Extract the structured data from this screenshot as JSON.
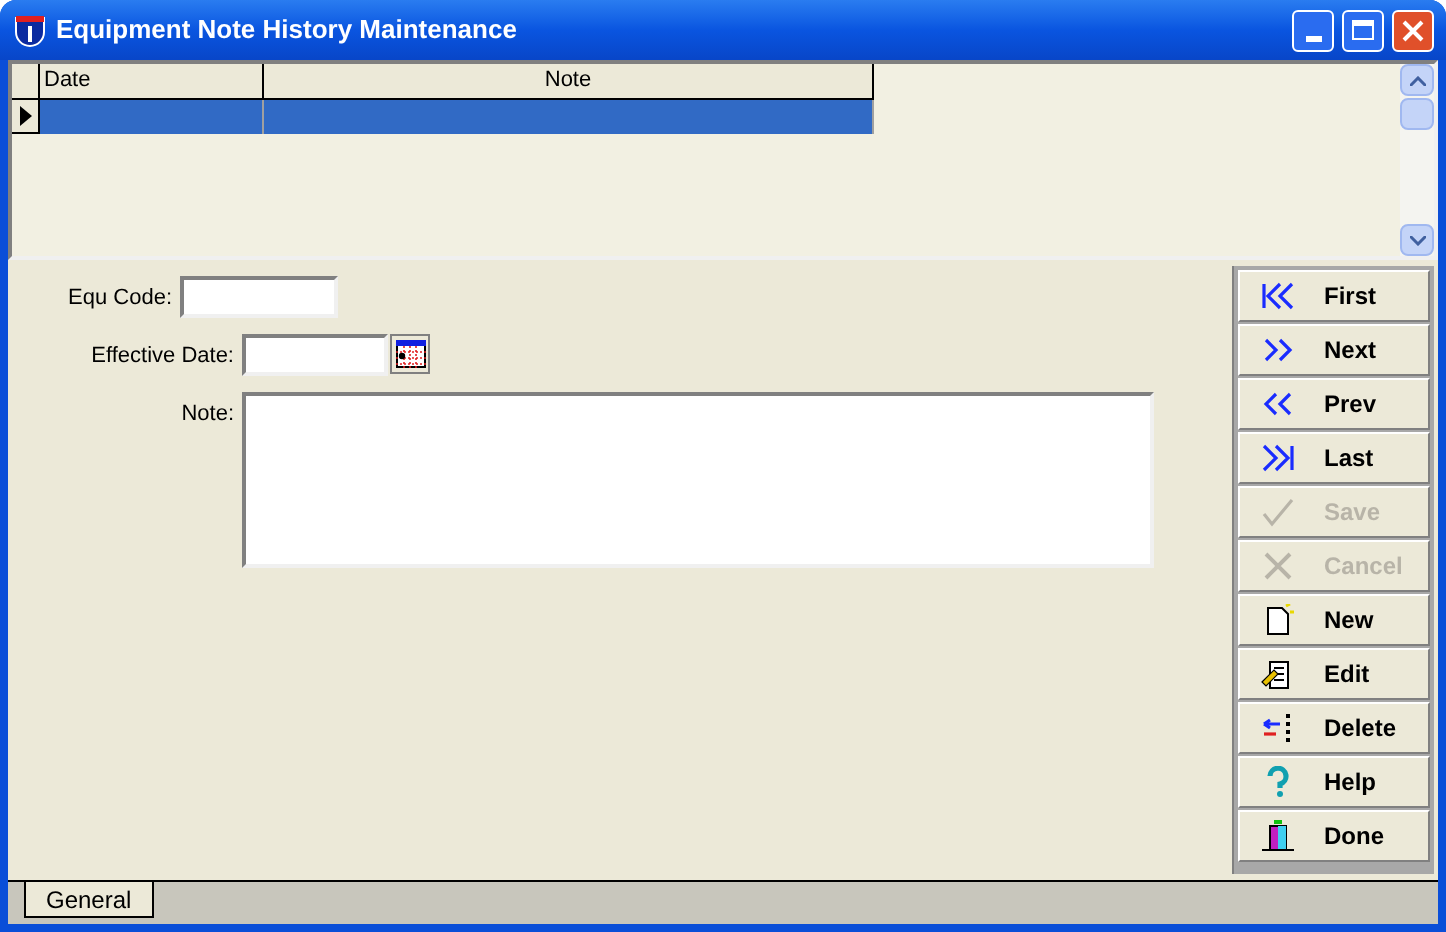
{
  "window": {
    "title": "Equipment Note History Maintenance"
  },
  "grid": {
    "columns": [
      "Date",
      "Note"
    ],
    "rows": [
      {
        "selected": true,
        "cells": [
          "",
          ""
        ]
      }
    ]
  },
  "form": {
    "fields": [
      {
        "label": "Equ Code:",
        "kind": "text"
      },
      {
        "label": "Effective Date:",
        "kind": "date"
      },
      {
        "label": "Note:",
        "kind": "memo"
      }
    ]
  },
  "buttons": [
    {
      "label": "First",
      "kind": "first",
      "disabled": false
    },
    {
      "label": "Next",
      "kind": "next",
      "disabled": false
    },
    {
      "label": "Prev",
      "kind": "prev",
      "disabled": false
    },
    {
      "label": "Last",
      "kind": "last",
      "disabled": false
    },
    {
      "label": "Save",
      "kind": "save",
      "disabled": true
    },
    {
      "label": "Cancel",
      "kind": "cancel",
      "disabled": true
    },
    {
      "label": "New",
      "kind": "new",
      "disabled": false
    },
    {
      "label": "Edit",
      "kind": "edit",
      "disabled": false
    },
    {
      "label": "Delete",
      "kind": "delete",
      "disabled": false
    },
    {
      "label": "Help",
      "kind": "help",
      "disabled": false
    },
    {
      "label": "Done",
      "kind": "done",
      "disabled": false
    }
  ],
  "tabs": [
    {
      "label": "General",
      "selected": true
    }
  ]
}
